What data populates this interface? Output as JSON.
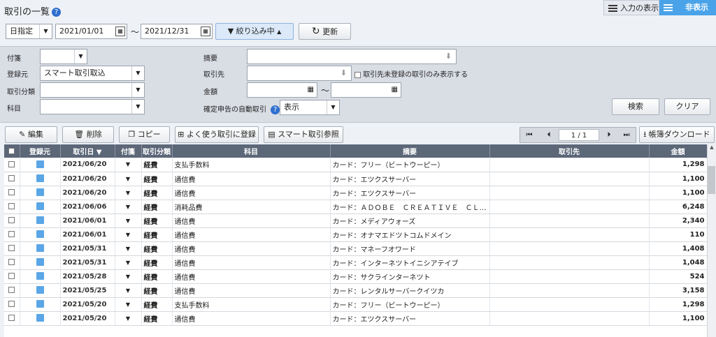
{
  "header": {
    "title": "取引の一覧",
    "help": "?",
    "view_input": "入力の表示",
    "hide": "非表示"
  },
  "toolbar": {
    "period_type": "日指定",
    "date_from": "2021/01/01",
    "tilde": "〜",
    "date_to": "2021/12/31",
    "filter_label": "絞り込み中",
    "refresh_label": "更新"
  },
  "filters": {
    "tag_label": "付箋",
    "source_label": "登録元",
    "source_value": "スマート取引取込",
    "type_label": "取引分類",
    "account_label": "科目",
    "summary_label": "摘要",
    "partner_label": "取引先",
    "unregistered_label": "取引先未登録の取引のみ表示する",
    "amount_label": "金額",
    "amount_tilde": "〜",
    "auto_label": "確定申告の自動取引",
    "auto_value": "表示",
    "search_btn": "検索",
    "clear_btn": "クリア"
  },
  "actions": {
    "edit": "編集",
    "delete": "削除",
    "copy": "コピー",
    "favorite": "よく使う取引に登録",
    "smart_ref": "スマート取引参照",
    "page_current": "1",
    "page_sep": "/",
    "page_total": "1",
    "download": "帳簿ダウンロード"
  },
  "columns": [
    "登録元",
    "取引日 ▼",
    "付箋",
    "取引分類",
    "科目",
    "摘要",
    "取引先",
    "金額"
  ],
  "rows": [
    {
      "date": "2021/06/20",
      "type": "経費",
      "account": "支払手数料",
      "summary": "カード：フリー（ビートウーピー）",
      "amount": "1,298"
    },
    {
      "date": "2021/06/20",
      "type": "経費",
      "account": "通信費",
      "summary": "カード：エツクスサーバー",
      "amount": "1,100"
    },
    {
      "date": "2021/06/20",
      "type": "経費",
      "account": "通信費",
      "summary": "カード：エツクスサーバー",
      "amount": "1,100"
    },
    {
      "date": "2021/06/06",
      "type": "経費",
      "account": "消耗品費",
      "summary": "カード：ＡＤＯＢＥ　ＣＲＥＡＴＩＶＥ　ＣＬ…",
      "amount": "6,248"
    },
    {
      "date": "2021/06/01",
      "type": "経費",
      "account": "通信費",
      "summary": "カード：メディアウォーズ",
      "amount": "2,340"
    },
    {
      "date": "2021/06/01",
      "type": "経費",
      "account": "通信費",
      "summary": "カード：オナマエドツトコムドメイン",
      "amount": "110"
    },
    {
      "date": "2021/05/31",
      "type": "経費",
      "account": "通信費",
      "summary": "カード：マネーフオワード",
      "amount": "1,408"
    },
    {
      "date": "2021/05/31",
      "type": "経費",
      "account": "通信費",
      "summary": "カード：インターネツトイニシアテイブ",
      "amount": "1,048"
    },
    {
      "date": "2021/05/28",
      "type": "経費",
      "account": "通信費",
      "summary": "カード：サクラインターネツト",
      "amount": "524"
    },
    {
      "date": "2021/05/25",
      "type": "経費",
      "account": "通信費",
      "summary": "カード：レンタルサーバークイツカ",
      "amount": "3,158"
    },
    {
      "date": "2021/05/20",
      "type": "経費",
      "account": "支払手数料",
      "summary": "カード：フリー（ビートウーピー）",
      "amount": "1,298"
    },
    {
      "date": "2021/05/20",
      "type": "経費",
      "account": "通信費",
      "summary": "カード：エツクスサーバー",
      "amount": "1,100"
    }
  ]
}
